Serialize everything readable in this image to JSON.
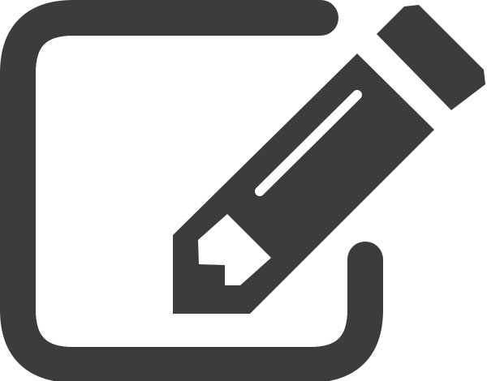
{
  "icon": {
    "name": "edit-icon",
    "color": "#3c3c3c",
    "background": "#ffffff"
  }
}
